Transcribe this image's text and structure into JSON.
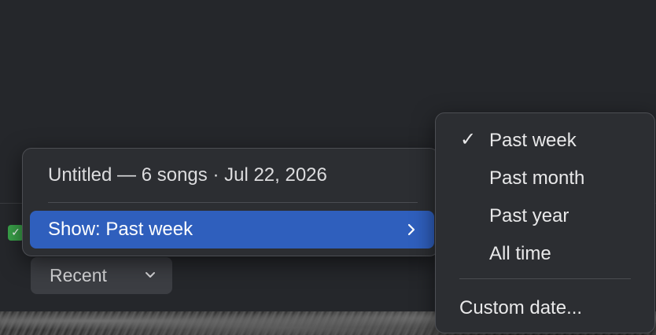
{
  "badge": {
    "glyph": "✓",
    "color": "#3aa34a"
  },
  "recent_button": {
    "label": "Recent",
    "icon": "chevron-down-icon"
  },
  "context_menu": {
    "header": "Untitled — 6 songs · Jul 22, 2026",
    "show_item": {
      "label": "Show: Past week",
      "icon": "chevron-right-icon",
      "highlight_color": "#2f5fbd"
    }
  },
  "submenu": {
    "checkmark": "✓",
    "items": [
      {
        "label": "Past week",
        "checked": true
      },
      {
        "label": "Past month",
        "checked": false
      },
      {
        "label": "Past year",
        "checked": false
      },
      {
        "label": "All time",
        "checked": false
      }
    ],
    "custom": {
      "label": "Custom date..."
    }
  }
}
